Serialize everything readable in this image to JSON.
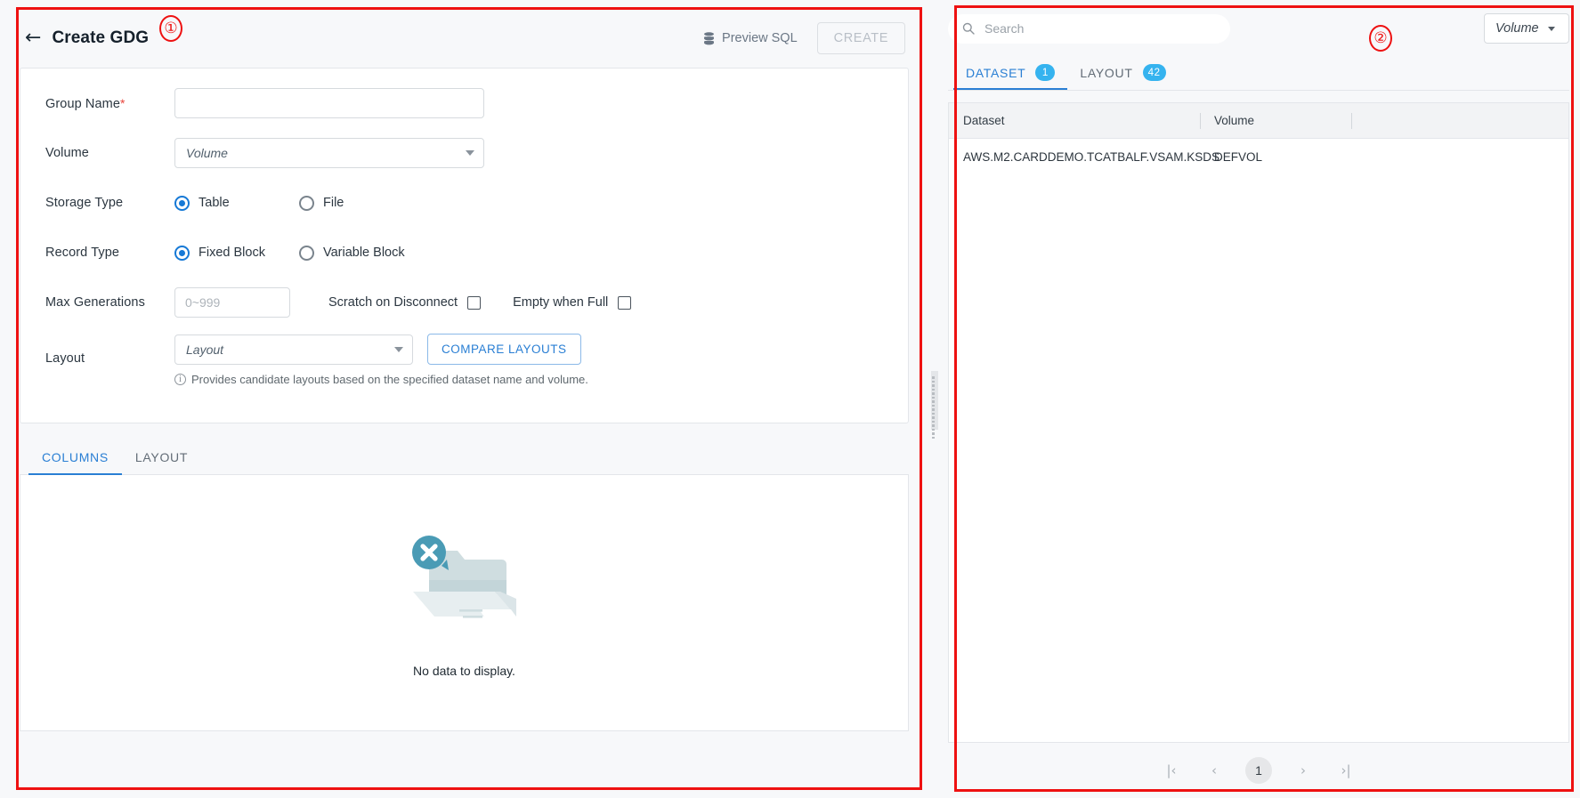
{
  "annotations": {
    "left_marker": "①",
    "right_marker": "②"
  },
  "left_panel": {
    "header": {
      "back_icon": "arrow-left-icon",
      "title": "Create GDG",
      "preview_sql_label": "Preview SQL",
      "create_label": "CREATE"
    },
    "form": {
      "group_name": {
        "label": "Group Name",
        "required_mark": "*",
        "value": "",
        "placeholder": ""
      },
      "volume": {
        "label": "Volume",
        "value": "Volume"
      },
      "storage_type": {
        "label": "Storage Type",
        "options": [
          {
            "label": "Table",
            "selected": true
          },
          {
            "label": "File",
            "selected": false
          }
        ]
      },
      "record_type": {
        "label": "Record Type",
        "options": [
          {
            "label": "Fixed Block",
            "selected": true
          },
          {
            "label": "Variable Block",
            "selected": false
          }
        ]
      },
      "max_generations": {
        "label": "Max Generations",
        "value": "",
        "placeholder": "0~999",
        "checkboxes": [
          {
            "label": "Scratch on Disconnect",
            "checked": false
          },
          {
            "label": "Empty when Full",
            "checked": false
          }
        ]
      },
      "layout": {
        "label": "Layout",
        "value": "Layout",
        "compare_button": "COMPARE LAYOUTS",
        "hint": "Provides candidate layouts based on the specified dataset name and volume."
      }
    },
    "lower": {
      "tabs": [
        {
          "label": "COLUMNS",
          "active": true
        },
        {
          "label": "LAYOUT",
          "active": false
        }
      ],
      "empty_state": {
        "icon": "folder-error-icon",
        "text": "No data to display."
      }
    }
  },
  "right_panel": {
    "search": {
      "icon": "search-icon",
      "value": "",
      "placeholder": "Search"
    },
    "volume_filter": {
      "value": "Volume",
      "icon": "chevron-down-icon"
    },
    "tabs": [
      {
        "label": "DATASET",
        "badge": "1",
        "active": true
      },
      {
        "label": "LAYOUT",
        "badge": "42",
        "active": false
      }
    ],
    "table": {
      "columns": [
        "Dataset",
        "Volume",
        ""
      ],
      "rows": [
        {
          "dataset": "AWS.M2.CARDDEMO.TCATBALF.VSAM.KSDS",
          "volume": "DEFVOL"
        }
      ]
    },
    "pagination": {
      "first": "|‹",
      "prev": "‹",
      "current": "1",
      "next": "›",
      "last": "›|"
    }
  },
  "colors": {
    "accent_blue": "#2a7fd4",
    "badge_blue": "#35b3ef",
    "required_red": "#e8453c",
    "annotation_red": "#ee1111",
    "empty_art_teal": "#4a9bb5"
  }
}
